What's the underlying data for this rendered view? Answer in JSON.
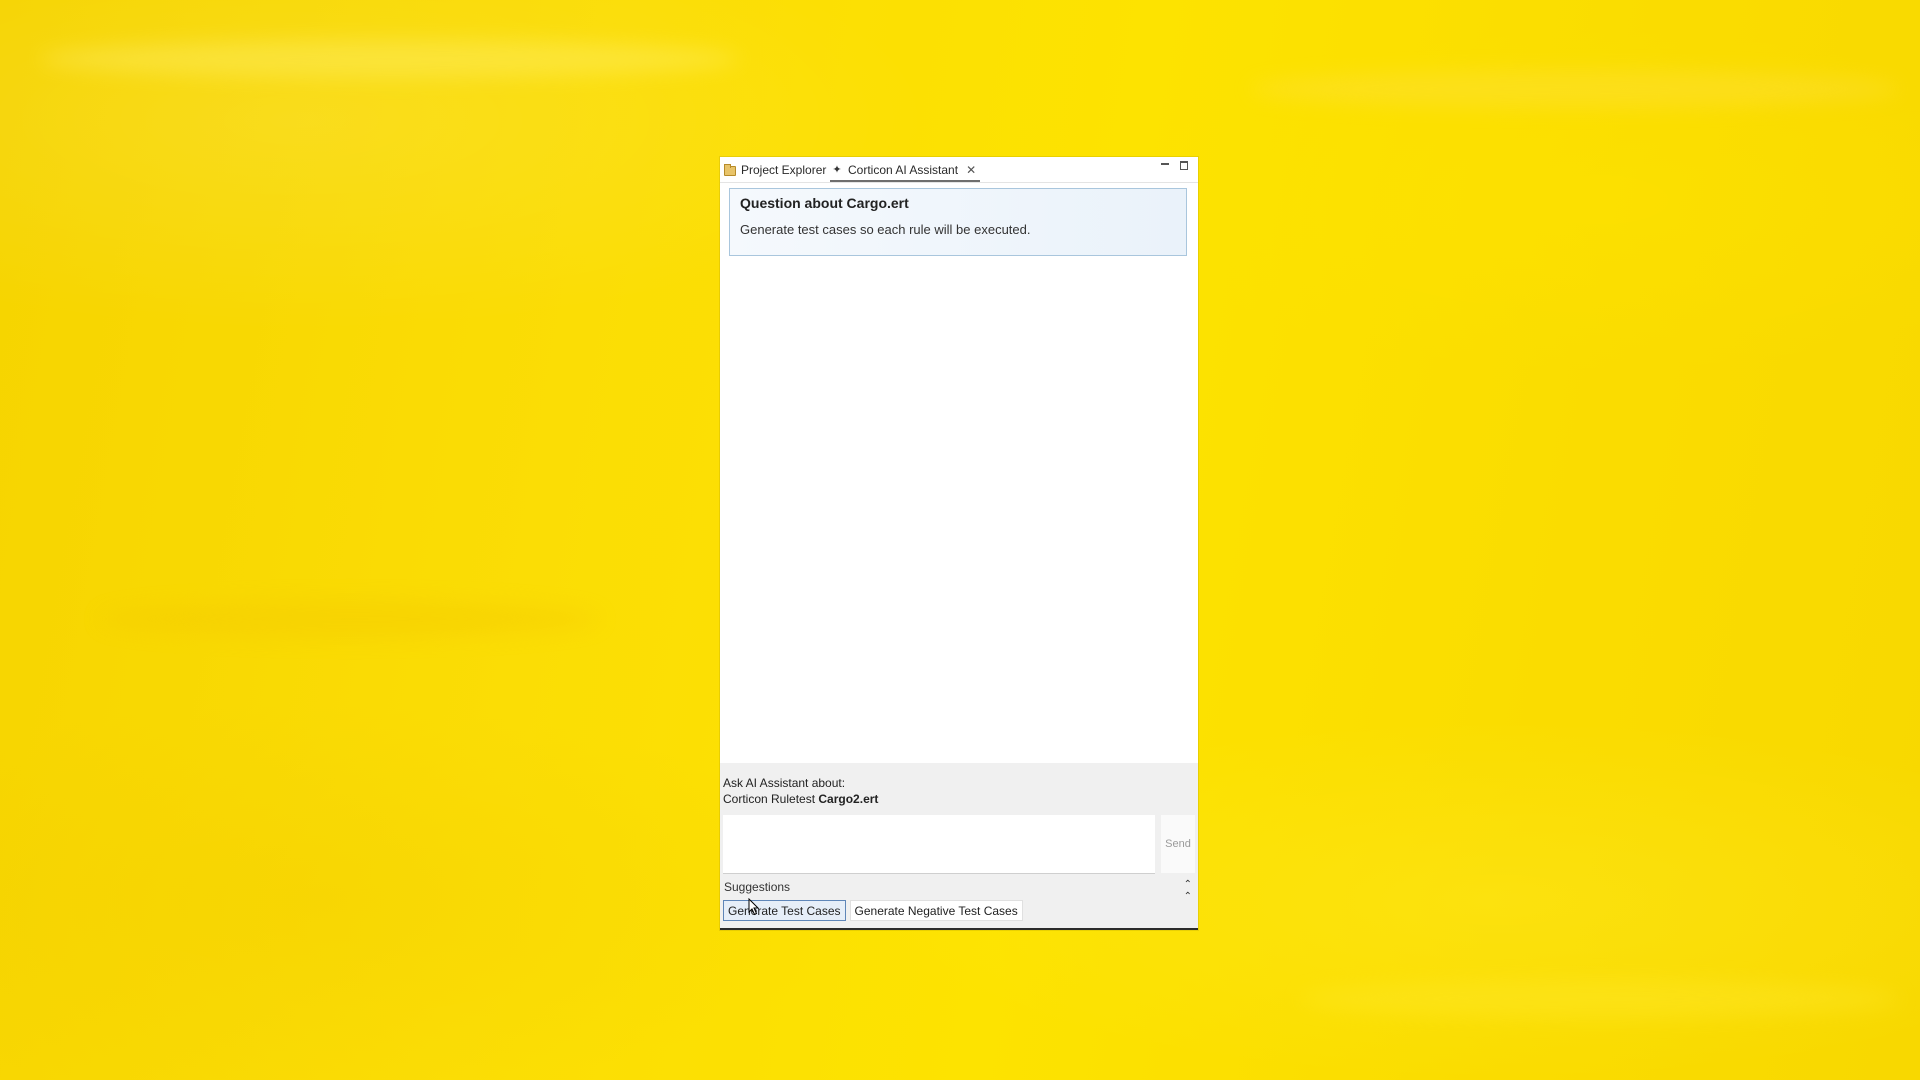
{
  "tabs": {
    "project_explorer": "Project Explorer",
    "assistant": "Corticon AI Assistant"
  },
  "question": {
    "title": "Question about Cargo.ert",
    "text": "Generate test cases so each rule will be executed."
  },
  "ask": {
    "label": "Ask AI Assistant about:",
    "context_prefix": "Corticon Ruletest",
    "context_file": "Cargo2.ert",
    "input_value": "",
    "send_label": "Send"
  },
  "suggestions": {
    "label": "Suggestions",
    "items": [
      {
        "label": "Generate Test Cases"
      },
      {
        "label": "Generate Negative Test Cases"
      }
    ]
  },
  "colors": {
    "background": "#fde300",
    "card_border": "#a9c6dd",
    "active_button_border": "#5f86b8"
  },
  "icons": {
    "project_explorer": "folder-icon",
    "assistant": "sparkle-icon",
    "close": "close-icon",
    "minimize": "minimize-icon",
    "maximize": "maximize-icon",
    "collapse": "chevron-double-up-icon"
  }
}
